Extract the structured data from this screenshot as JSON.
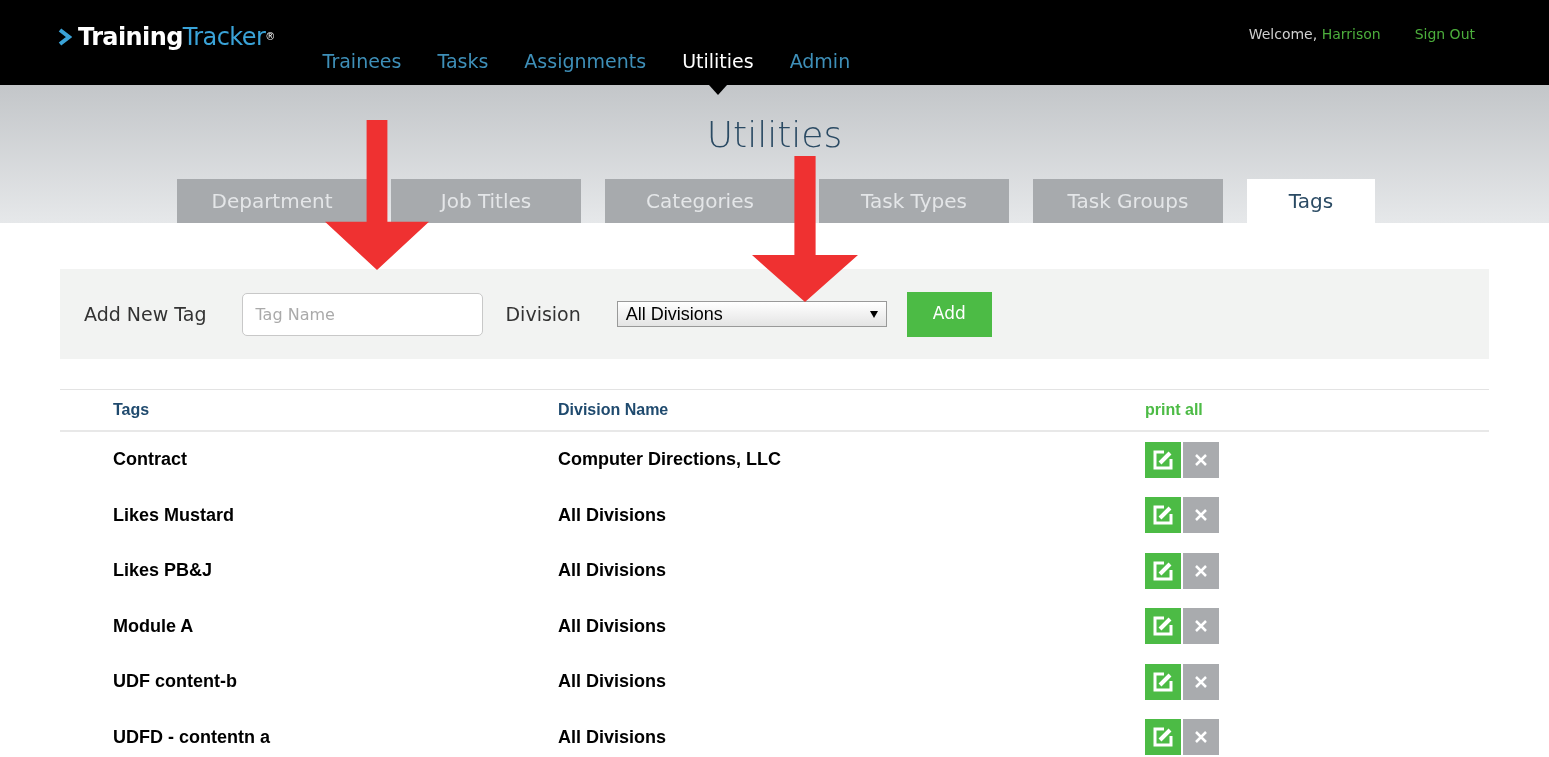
{
  "brand": {
    "first": "Training",
    "second": "Tracker",
    "mark": "®"
  },
  "nav": [
    {
      "label": "Trainees",
      "selected": false
    },
    {
      "label": "Tasks",
      "selected": false
    },
    {
      "label": "Assignments",
      "selected": false
    },
    {
      "label": "Utilities",
      "selected": true
    },
    {
      "label": "Admin",
      "selected": false
    }
  ],
  "user": {
    "welcome": "Welcome,",
    "name": "Harrison",
    "sign_out": "Sign Out"
  },
  "page_title": "Utilities",
  "tabs": [
    {
      "label": "Department",
      "selected": false
    },
    {
      "label": "Job Titles",
      "selected": false
    },
    {
      "label": "Categories",
      "selected": false
    },
    {
      "label": "Task Types",
      "selected": false
    },
    {
      "label": "Task Groups",
      "selected": false
    },
    {
      "label": "Tags",
      "selected": true
    }
  ],
  "form": {
    "label": "Add New Tag",
    "tag_name": {
      "placeholder": "Tag Name"
    },
    "division_label": "Division",
    "division": {
      "value": "All Divisions"
    },
    "add_button": "Add"
  },
  "table": {
    "columns": [
      "Tags",
      "Division Name"
    ],
    "print_all": "print all",
    "rows": [
      {
        "tag": "Contract",
        "division": "Computer Directions, LLC"
      },
      {
        "tag": "Likes Mustard",
        "division": "All Divisions"
      },
      {
        "tag": "Likes PB&J",
        "division": "All Divisions"
      },
      {
        "tag": "Module A",
        "division": "All Divisions"
      },
      {
        "tag": "UDF content-b",
        "division": "All Divisions"
      },
      {
        "tag": "UDFD - contentn a",
        "division": "All Divisions"
      }
    ]
  },
  "annotations": [
    {
      "kind": "arrow"
    },
    {
      "kind": "arrow"
    }
  ]
}
